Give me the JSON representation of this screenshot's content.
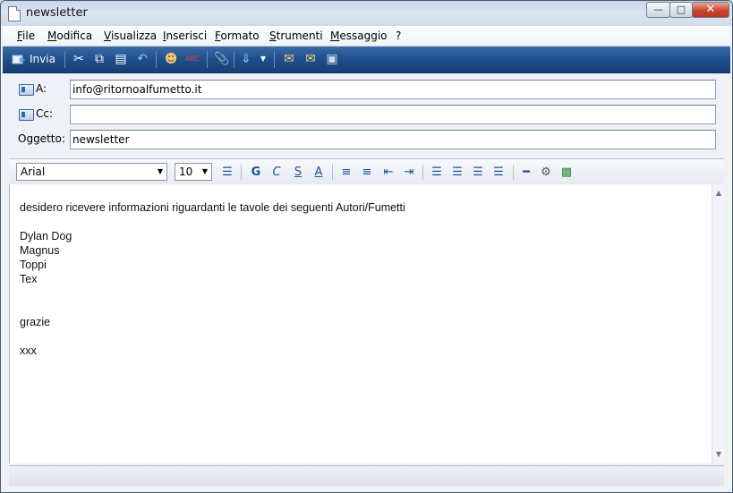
{
  "window": {
    "title": "newsletter",
    "minimize": "—",
    "maximize": "□",
    "close": "✕"
  },
  "menu": [
    "File",
    "Modifica",
    "Visualizza",
    "Inserisci",
    "Formato",
    "Strumenti",
    "Messaggio",
    "?"
  ],
  "toolbar": {
    "send_label": "Invia"
  },
  "header": {
    "to_label": "A:",
    "to_value": "info@ritornoalfumetto.it",
    "cc_label": "Cc:",
    "cc_value": "",
    "subject_label": "Oggetto:",
    "subject_value": "newsletter"
  },
  "format": {
    "font": "Arial",
    "size": "10"
  },
  "body": {
    "lines": [
      "desidero ricevere informazioni riguardanti le tavole dei seguenti Autori/Fumetti",
      "",
      "Dylan Dog",
      "Magnus",
      "Toppi",
      "Tex",
      "",
      "",
      "grazie",
      "",
      "xxx"
    ]
  },
  "icons": [
    "send-icon",
    "cut-icon",
    "copy-icon",
    "paste-icon",
    "undo-icon",
    "address-book-icon",
    "spellcheck-icon",
    "attach-icon",
    "priority-icon",
    "sign-icon",
    "encrypt-icon",
    "offline-icon"
  ]
}
